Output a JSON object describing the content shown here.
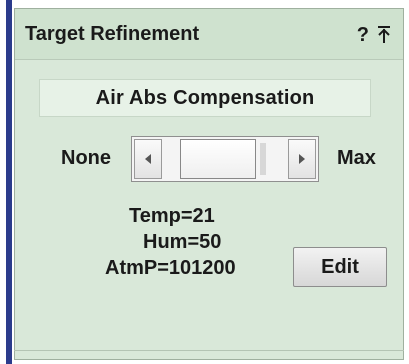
{
  "panel": {
    "title": "Target Refinement",
    "help_icon": "help-icon",
    "pin_icon": "pin-icon",
    "help_glyph": "?"
  },
  "air_abs": {
    "section_title": "Air Abs Compensation",
    "min_label": "None",
    "max_label": "Max",
    "slider_level": 0.35
  },
  "environment": {
    "temp": "Temp=21",
    "hum": "Hum=50",
    "atmp": "AtmP=101200"
  },
  "actions": {
    "edit_label": "Edit"
  },
  "colors": {
    "panel_bg": "#d9e8d9",
    "header_bg": "#cfe2cf",
    "section_bg": "#e7f2e7",
    "left_accent": "#2b3b8c"
  }
}
